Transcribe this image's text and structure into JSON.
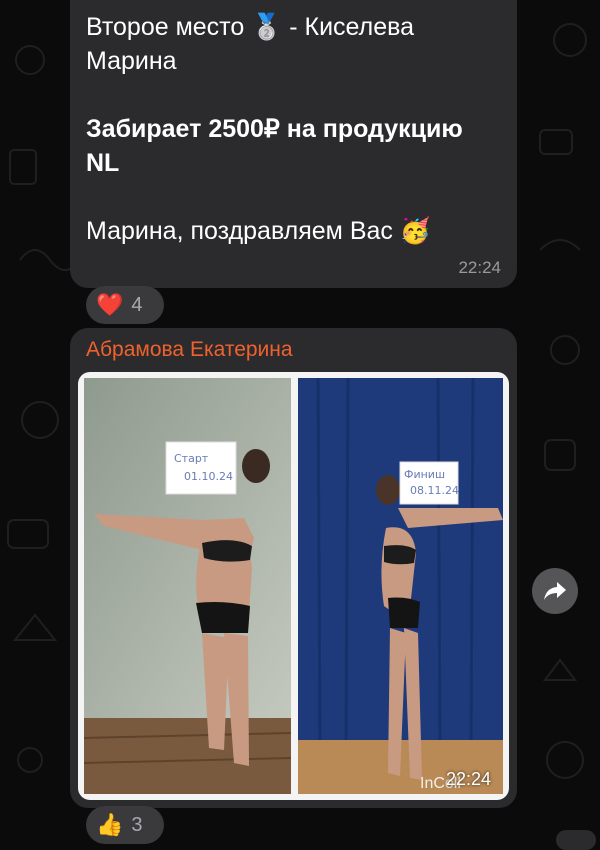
{
  "messages": [
    {
      "lines": [
        {
          "text": "Второе место 🥈 - Киселева",
          "bold": false
        },
        {
          "text": "Марина",
          "bold": false
        },
        {
          "text": "",
          "bold": false
        },
        {
          "text": "Забирает 2500₽ на продукцию",
          "bold": true
        },
        {
          "text": "NL",
          "bold": true
        },
        {
          "text": "",
          "bold": false
        },
        {
          "text": "Марина, поздравляем Вас 🥳",
          "bold": false
        }
      ],
      "time": "22:24",
      "reaction": {
        "emoji": "❤️",
        "count": "4"
      }
    },
    {
      "sender": "Абрамова Екатерина",
      "photos": [
        {
          "sign_line1": "Старт",
          "sign_line2": "01.10.24"
        },
        {
          "sign_line1": "Финиш",
          "sign_line2": "08.11.24"
        }
      ],
      "watermark": "InColl",
      "time": "22:24",
      "reaction": {
        "emoji": "👍",
        "count": "3"
      }
    }
  ],
  "colors": {
    "background": "#0b0b0c",
    "bubble": "#2b2b2d",
    "sender_name": "#f0622d",
    "reaction_pill": "#3a3a3d"
  },
  "icons": {
    "share": "share-arrow-icon"
  }
}
